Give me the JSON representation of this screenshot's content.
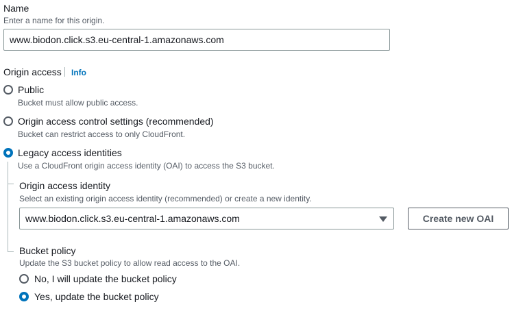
{
  "name_section": {
    "label": "Name",
    "description": "Enter a name for this origin.",
    "value": "www.biodon.click.s3.eu-central-1.amazonaws.com"
  },
  "origin_access": {
    "label": "Origin access",
    "info_link": "Info",
    "options": [
      {
        "label": "Public",
        "description": "Bucket must allow public access.",
        "selected": false
      },
      {
        "label": "Origin access control settings (recommended)",
        "description": "Bucket can restrict access to only CloudFront.",
        "selected": false
      },
      {
        "label": "Legacy access identities",
        "description": "Use a CloudFront origin access identity (OAI) to access the S3 bucket.",
        "selected": true
      }
    ]
  },
  "oai": {
    "label": "Origin access identity",
    "description": "Select an existing origin access identity (recommended) or create a new identity.",
    "selected_value": "www.biodon.click.s3.eu-central-1.amazonaws.com",
    "create_button": "Create new OAI"
  },
  "bucket_policy": {
    "label": "Bucket policy",
    "description": "Update the S3 bucket policy to allow read access to the OAI.",
    "options": [
      {
        "label": "No, I will update the bucket policy",
        "selected": false
      },
      {
        "label": "Yes, update the bucket policy",
        "selected": true
      }
    ]
  },
  "colors": {
    "accent": "#0073bb",
    "text": "#16191f",
    "muted": "#545b64",
    "border": "#879596"
  }
}
